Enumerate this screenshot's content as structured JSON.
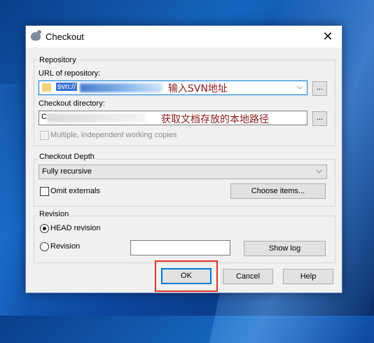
{
  "window": {
    "title": "Checkout",
    "close_glyph": "✕"
  },
  "repository": {
    "group_label": "Repository",
    "url_label": "URL of repository:",
    "url_value": "svn://",
    "url_annotation": "输入SVN地址",
    "browse_label": "...",
    "dir_label": "Checkout directory:",
    "dir_value": "C:",
    "dir_annotation": "获取文档存放的本地路径",
    "multiple_label": "Multiple, independent working copies"
  },
  "depth": {
    "group_label": "Checkout Depth",
    "selected": "Fully recursive",
    "omit_label": "Omit externals",
    "choose_items_label": "Choose items..."
  },
  "revision": {
    "group_label": "Revision",
    "head_label": "HEAD revision",
    "revision_label": "Revision",
    "revision_value": "",
    "show_log_label": "Show log"
  },
  "buttons": {
    "ok": "OK",
    "cancel": "Cancel",
    "help": "Help"
  },
  "colors": {
    "accent": "#0078d7",
    "annotation": "#8b1a1a",
    "highlight": "#e0332a"
  }
}
